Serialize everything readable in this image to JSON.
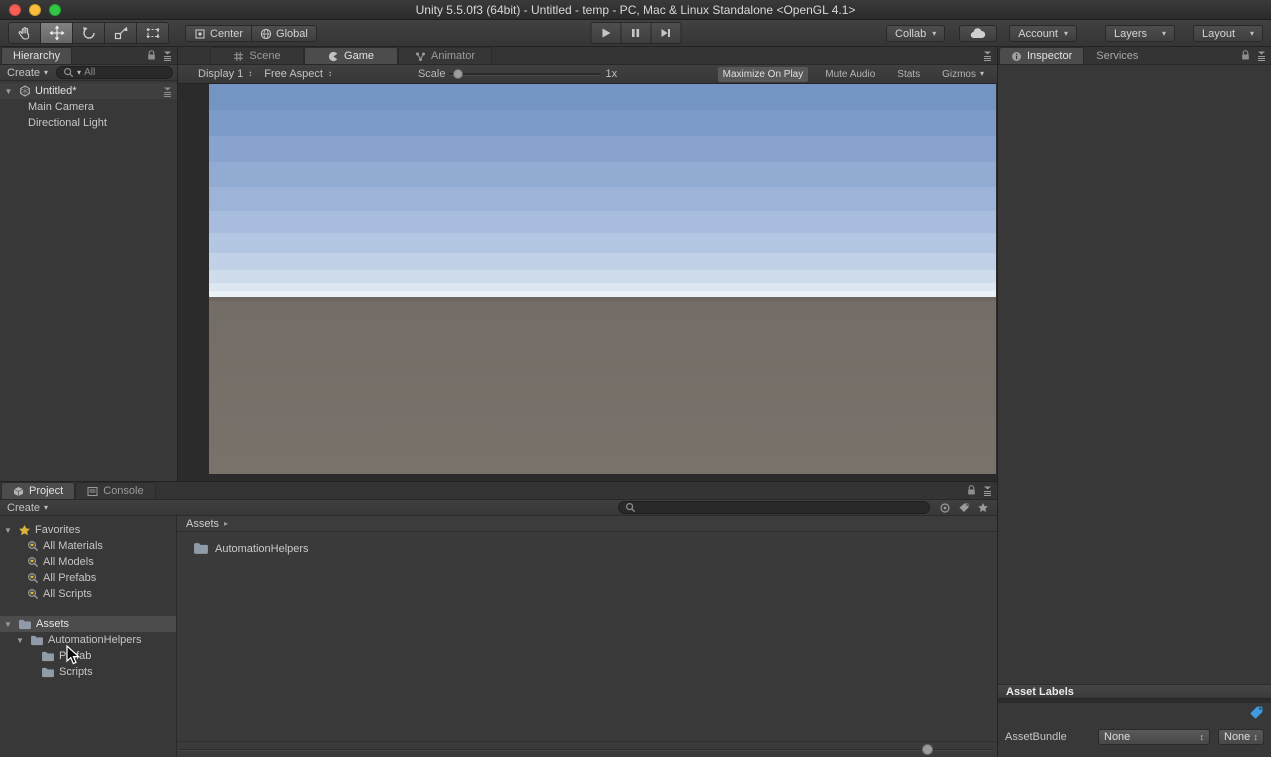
{
  "window": {
    "title": "Unity 5.5.0f3 (64bit) - Untitled - temp - PC, Mac & Linux Standalone <OpenGL 4.1>"
  },
  "icons": {
    "dropdown": "▾",
    "fold_open": "▼",
    "breadcrumb_arrow": "▸",
    "updown": "↕"
  },
  "toolbar": {
    "pivot_label": "Center",
    "space_label": "Global",
    "collab_label": "Collab",
    "account_label": "Account",
    "layers_label": "Layers",
    "layout_label": "Layout"
  },
  "hierarchy": {
    "tab_label": "Hierarchy",
    "create_label": "Create",
    "search_filter": "All",
    "scene_name": "Untitled*",
    "items": [
      {
        "label": "Main Camera"
      },
      {
        "label": "Directional Light"
      }
    ]
  },
  "viewport": {
    "tabs": [
      {
        "label": "Scene"
      },
      {
        "label": "Game"
      },
      {
        "label": "Animator"
      }
    ],
    "display_label": "Display 1",
    "aspect_label": "Free Aspect",
    "scale_label": "Scale",
    "scale_value": "1x",
    "maximize_label": "Maximize On Play",
    "mute_label": "Mute Audio",
    "stats_label": "Stats",
    "gizmos_label": "Gizmos"
  },
  "project": {
    "tab_project": "Project",
    "tab_console": "Console",
    "create_label": "Create",
    "favorites_label": "Favorites",
    "favorites": [
      {
        "label": "All Materials"
      },
      {
        "label": "All Models"
      },
      {
        "label": "All Prefabs"
      },
      {
        "label": "All Scripts"
      }
    ],
    "tree": {
      "root_label": "Assets",
      "folder_label": "AutomationHelpers",
      "subfolders": [
        {
          "label": "Prefab"
        },
        {
          "label": "Scripts"
        }
      ]
    },
    "breadcrumb": "Assets",
    "content_items": [
      {
        "label": "AutomationHelpers"
      }
    ]
  },
  "inspector": {
    "tab_inspector": "Inspector",
    "tab_services": "Services",
    "asset_labels_title": "Asset Labels",
    "assetbundle_label": "AssetBundle",
    "assetbundle_value": "None",
    "variant_value": "None"
  },
  "colors": {
    "selection_gray": "#4c4c4c",
    "label_tag_blue": "#3e9bdf",
    "favorites_star_yellow": "#d9b437",
    "sky_top": "#7494c4",
    "sky_horizon": "#ebf2f7",
    "ground": "#746d67"
  }
}
